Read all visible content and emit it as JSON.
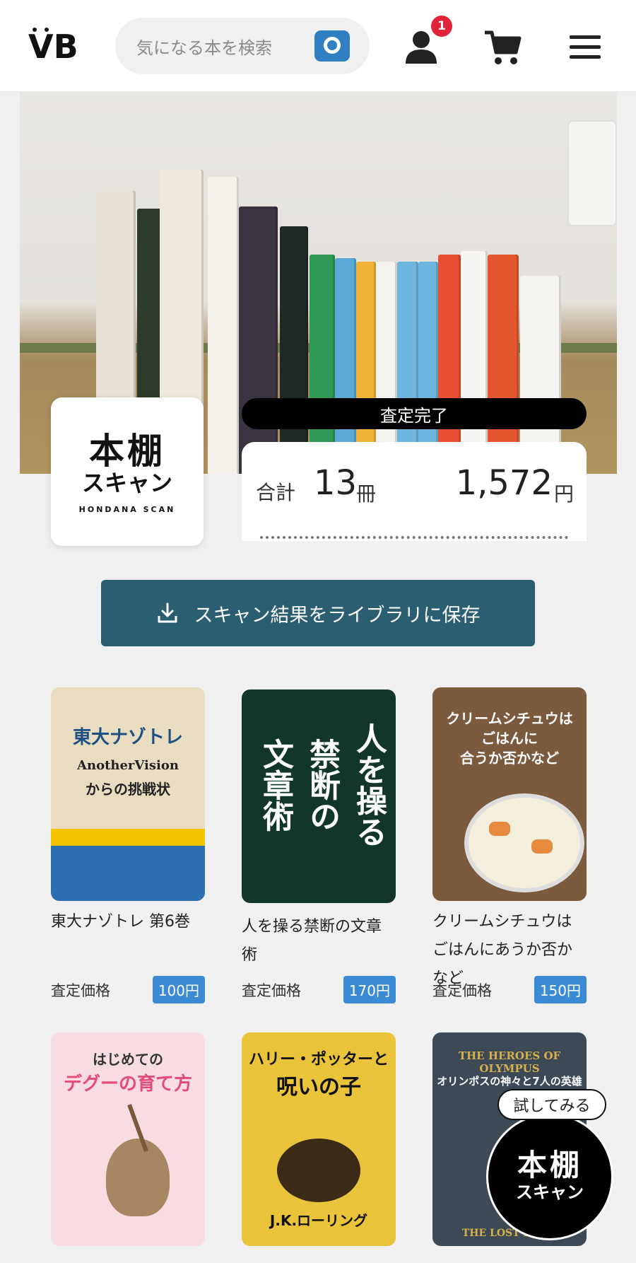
{
  "header": {
    "logo_text": "VB",
    "search_placeholder": "気になる本を検索",
    "notification_count": "1"
  },
  "hero": {
    "card_title": "本棚",
    "card_subtitle": "スキャン",
    "card_en": "HONDANA SCAN",
    "status": "査定完了"
  },
  "summary": {
    "total_label": "合計",
    "count": "13",
    "count_unit": "冊",
    "price": "1,572",
    "price_unit": "円"
  },
  "save_button": {
    "label": "スキャン結果をライブラリに保存"
  },
  "books": [
    {
      "title": "東大ナゾトレ 第6巻",
      "price_label": "査定価格",
      "price": "100円",
      "cover_line1": "東大ナゾトレ",
      "cover_line2": "AnotherVision",
      "cover_line3": "からの挑戦状"
    },
    {
      "title": "人を操る禁断の文章術",
      "price_label": "査定価格",
      "price": "170円",
      "cover_line1": "人を操る",
      "cover_line2": "禁断の",
      "cover_line3": "文章術"
    },
    {
      "title": "クリームシチュウはごはんにあうか否かなど",
      "price_label": "査定価格",
      "price": "150円",
      "cover_line1": "クリームシチュウは",
      "cover_line2": "ごはんに",
      "cover_line3": "合うか否かなど"
    },
    {
      "title": "",
      "cover_line1": "はじめての",
      "cover_line2": "デグーの育て方"
    },
    {
      "title": "",
      "cover_line1": "ハリー・ポッターと",
      "cover_line2": "呪いの子",
      "cover_line3": "J.K.ローリング"
    },
    {
      "title": "",
      "cover_line1": "THE HEROES OF OLYMPUS",
      "cover_line2": "オリンポスの神々と7人の英雄",
      "cover_line3": "THE LOST HERO"
    }
  ],
  "try_widget": {
    "bubble": "試してみる",
    "title": "本棚",
    "subtitle": "スキャン"
  }
}
